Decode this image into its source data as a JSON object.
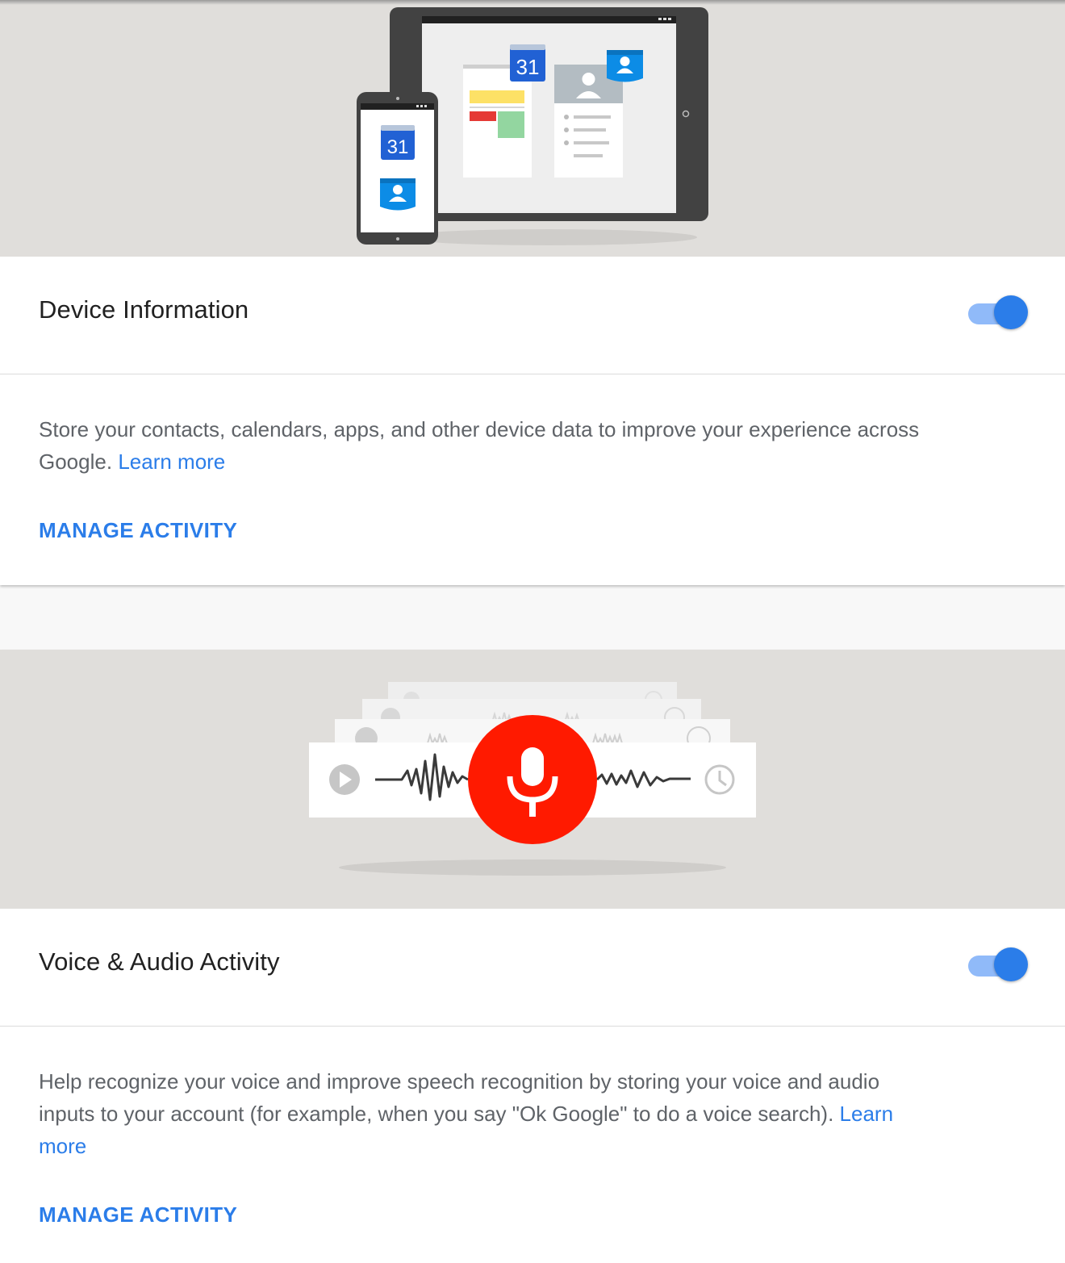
{
  "sections": [
    {
      "title": "Device Information",
      "toggle_on": true,
      "description": "Store your contacts, calendars, apps, and other device data to improve your experience across Google.",
      "learn_more": "Learn more",
      "manage": "MANAGE ACTIVITY",
      "illustration": {
        "calendar_day": "31"
      }
    },
    {
      "title": "Voice & Audio Activity",
      "toggle_on": true,
      "description": "Help recognize your voice and improve speech recognition by storing your voice and audio inputs to your account (for example, when you say \"Ok Google\" to do a voice search).",
      "learn_more": "Learn more",
      "manage": "MANAGE ACTIVITY"
    }
  ],
  "colors": {
    "accent": "#2b7de9",
    "toggle_track": "#90baf9",
    "hero_bg": "#e0dedb",
    "mic_red": "#ff1a00"
  }
}
